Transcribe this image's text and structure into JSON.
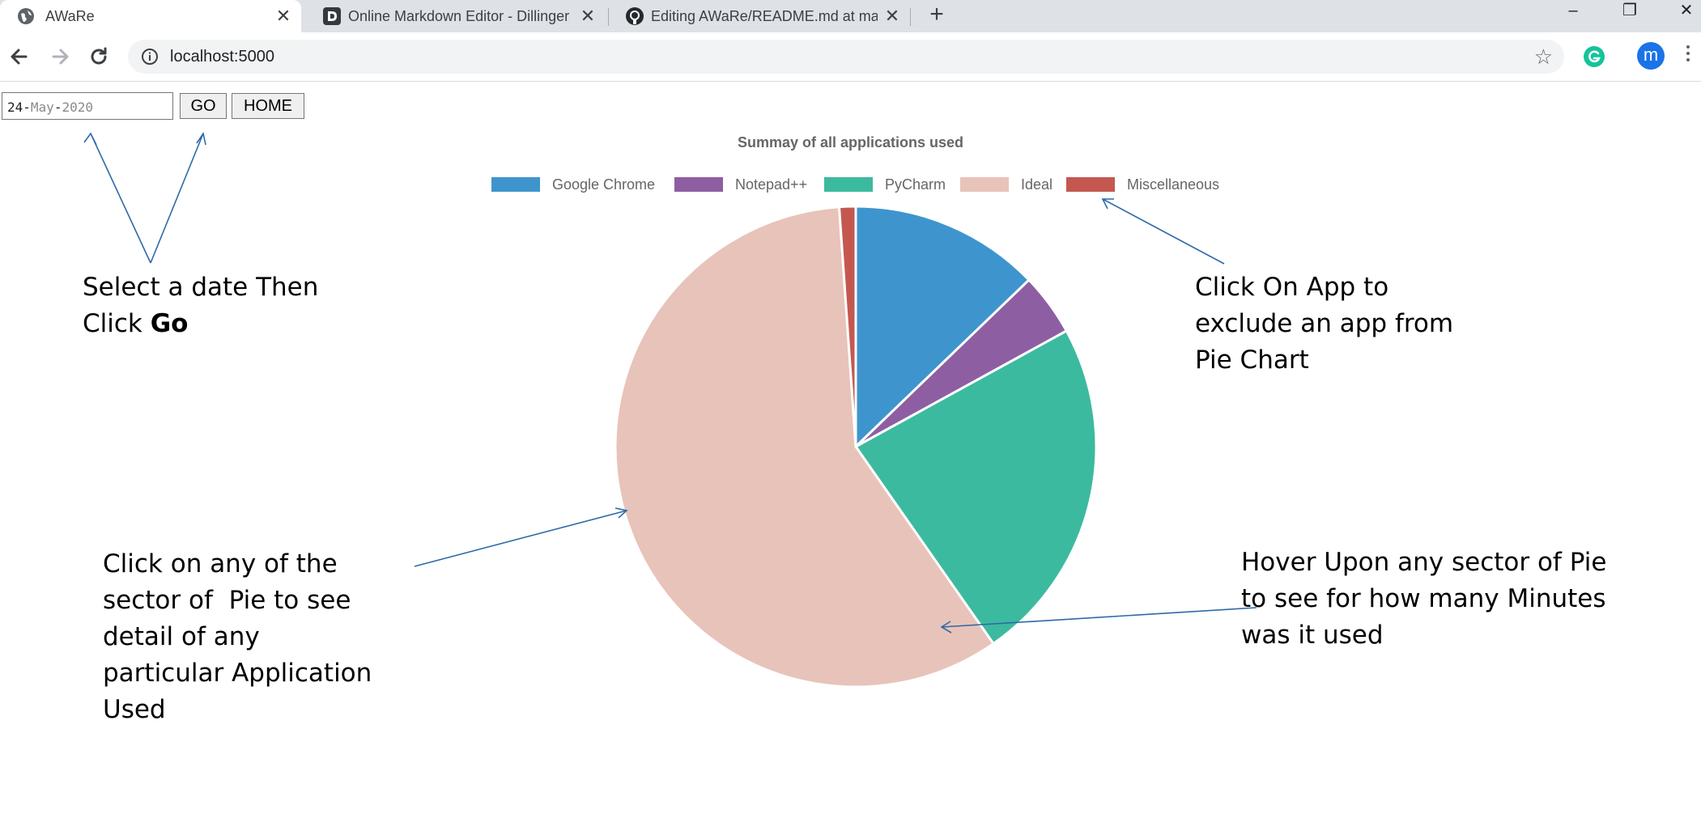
{
  "browser": {
    "tabs": [
      {
        "title": "AWaRe",
        "active": true
      },
      {
        "title": "Online Markdown Editor - Dillinger",
        "active": false
      },
      {
        "title": "Editing AWaRe/README.md at master",
        "active": false
      }
    ],
    "url": "localhost:5000",
    "avatar_letter": "m"
  },
  "controls": {
    "date": {
      "day": "24",
      "month": "May",
      "year": "2020",
      "sep": "-"
    },
    "go_label": "GO",
    "home_label": "HOME"
  },
  "chart_data": {
    "type": "pie",
    "title": "Summay of all applications used",
    "categories": [
      "Google Chrome",
      "Notepad++",
      "PyCharm",
      "Ideal",
      "Miscellaneous"
    ],
    "values": [
      12.8,
      4.2,
      23.3,
      58.6,
      1.1
    ],
    "colors": [
      "#3e95cd",
      "#8e5ea2",
      "#3cba9f",
      "#e8c3b9",
      "#c45850"
    ],
    "legend_position": "top"
  },
  "annotations": {
    "date_help_line1": "Select a date Then",
    "date_help_line2_prefix": "Click ",
    "date_help_line2_bold": "Go",
    "legend_help": [
      "Click On App to",
      "exclude an app from",
      "Pie Chart"
    ],
    "sector_help": [
      "Click on any of the",
      "sector of  Pie to see",
      "detail of any",
      "particular Application",
      "Used"
    ],
    "hover_help": [
      "Hover Upon any sector of Pie",
      "to see for how many Minutes",
      "was it used"
    ]
  }
}
